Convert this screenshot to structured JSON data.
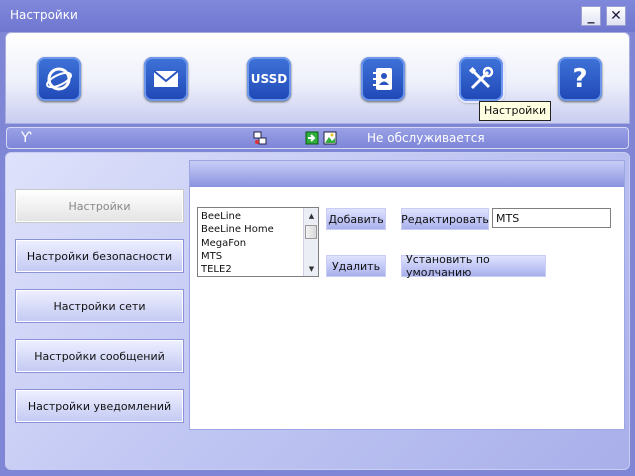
{
  "window": {
    "title": "Настройки",
    "minimize_label": "_",
    "close_label": "✕"
  },
  "toolbar": {
    "tools": [
      {
        "name": "internet-icon",
        "label": ""
      },
      {
        "name": "mail-icon",
        "label": ""
      },
      {
        "name": "ussd-icon",
        "label": "USSD"
      },
      {
        "name": "contacts-icon",
        "label": ""
      },
      {
        "name": "settings-tools-icon",
        "label": ""
      },
      {
        "name": "help-icon",
        "label": "?"
      }
    ],
    "tooltip": "Настройки"
  },
  "status": {
    "text": "Не обслуживается",
    "icons": [
      "antenna-icon",
      "network-icon",
      "import-icon",
      "image-icon"
    ]
  },
  "sidebar": {
    "items": [
      {
        "label": "Настройки",
        "active": true
      },
      {
        "label": "Настройки безопасности",
        "active": false
      },
      {
        "label": "Настройки сети",
        "active": false
      },
      {
        "label": "Настройки сообщений",
        "active": false
      },
      {
        "label": "Настройки уведомлений",
        "active": false
      }
    ]
  },
  "profiles": {
    "items": [
      "BeeLine",
      "BeeLine Home",
      "MegaFon",
      "MTS",
      "TELE2"
    ],
    "add_label": "Добавить",
    "delete_label": "Удалить",
    "edit_label": "Редактировать",
    "default_label": "Установить по умолчанию",
    "edit_value": "MTS"
  },
  "colors": {
    "accent": "#7f86d6",
    "tool_blue": "#1f47b6"
  }
}
